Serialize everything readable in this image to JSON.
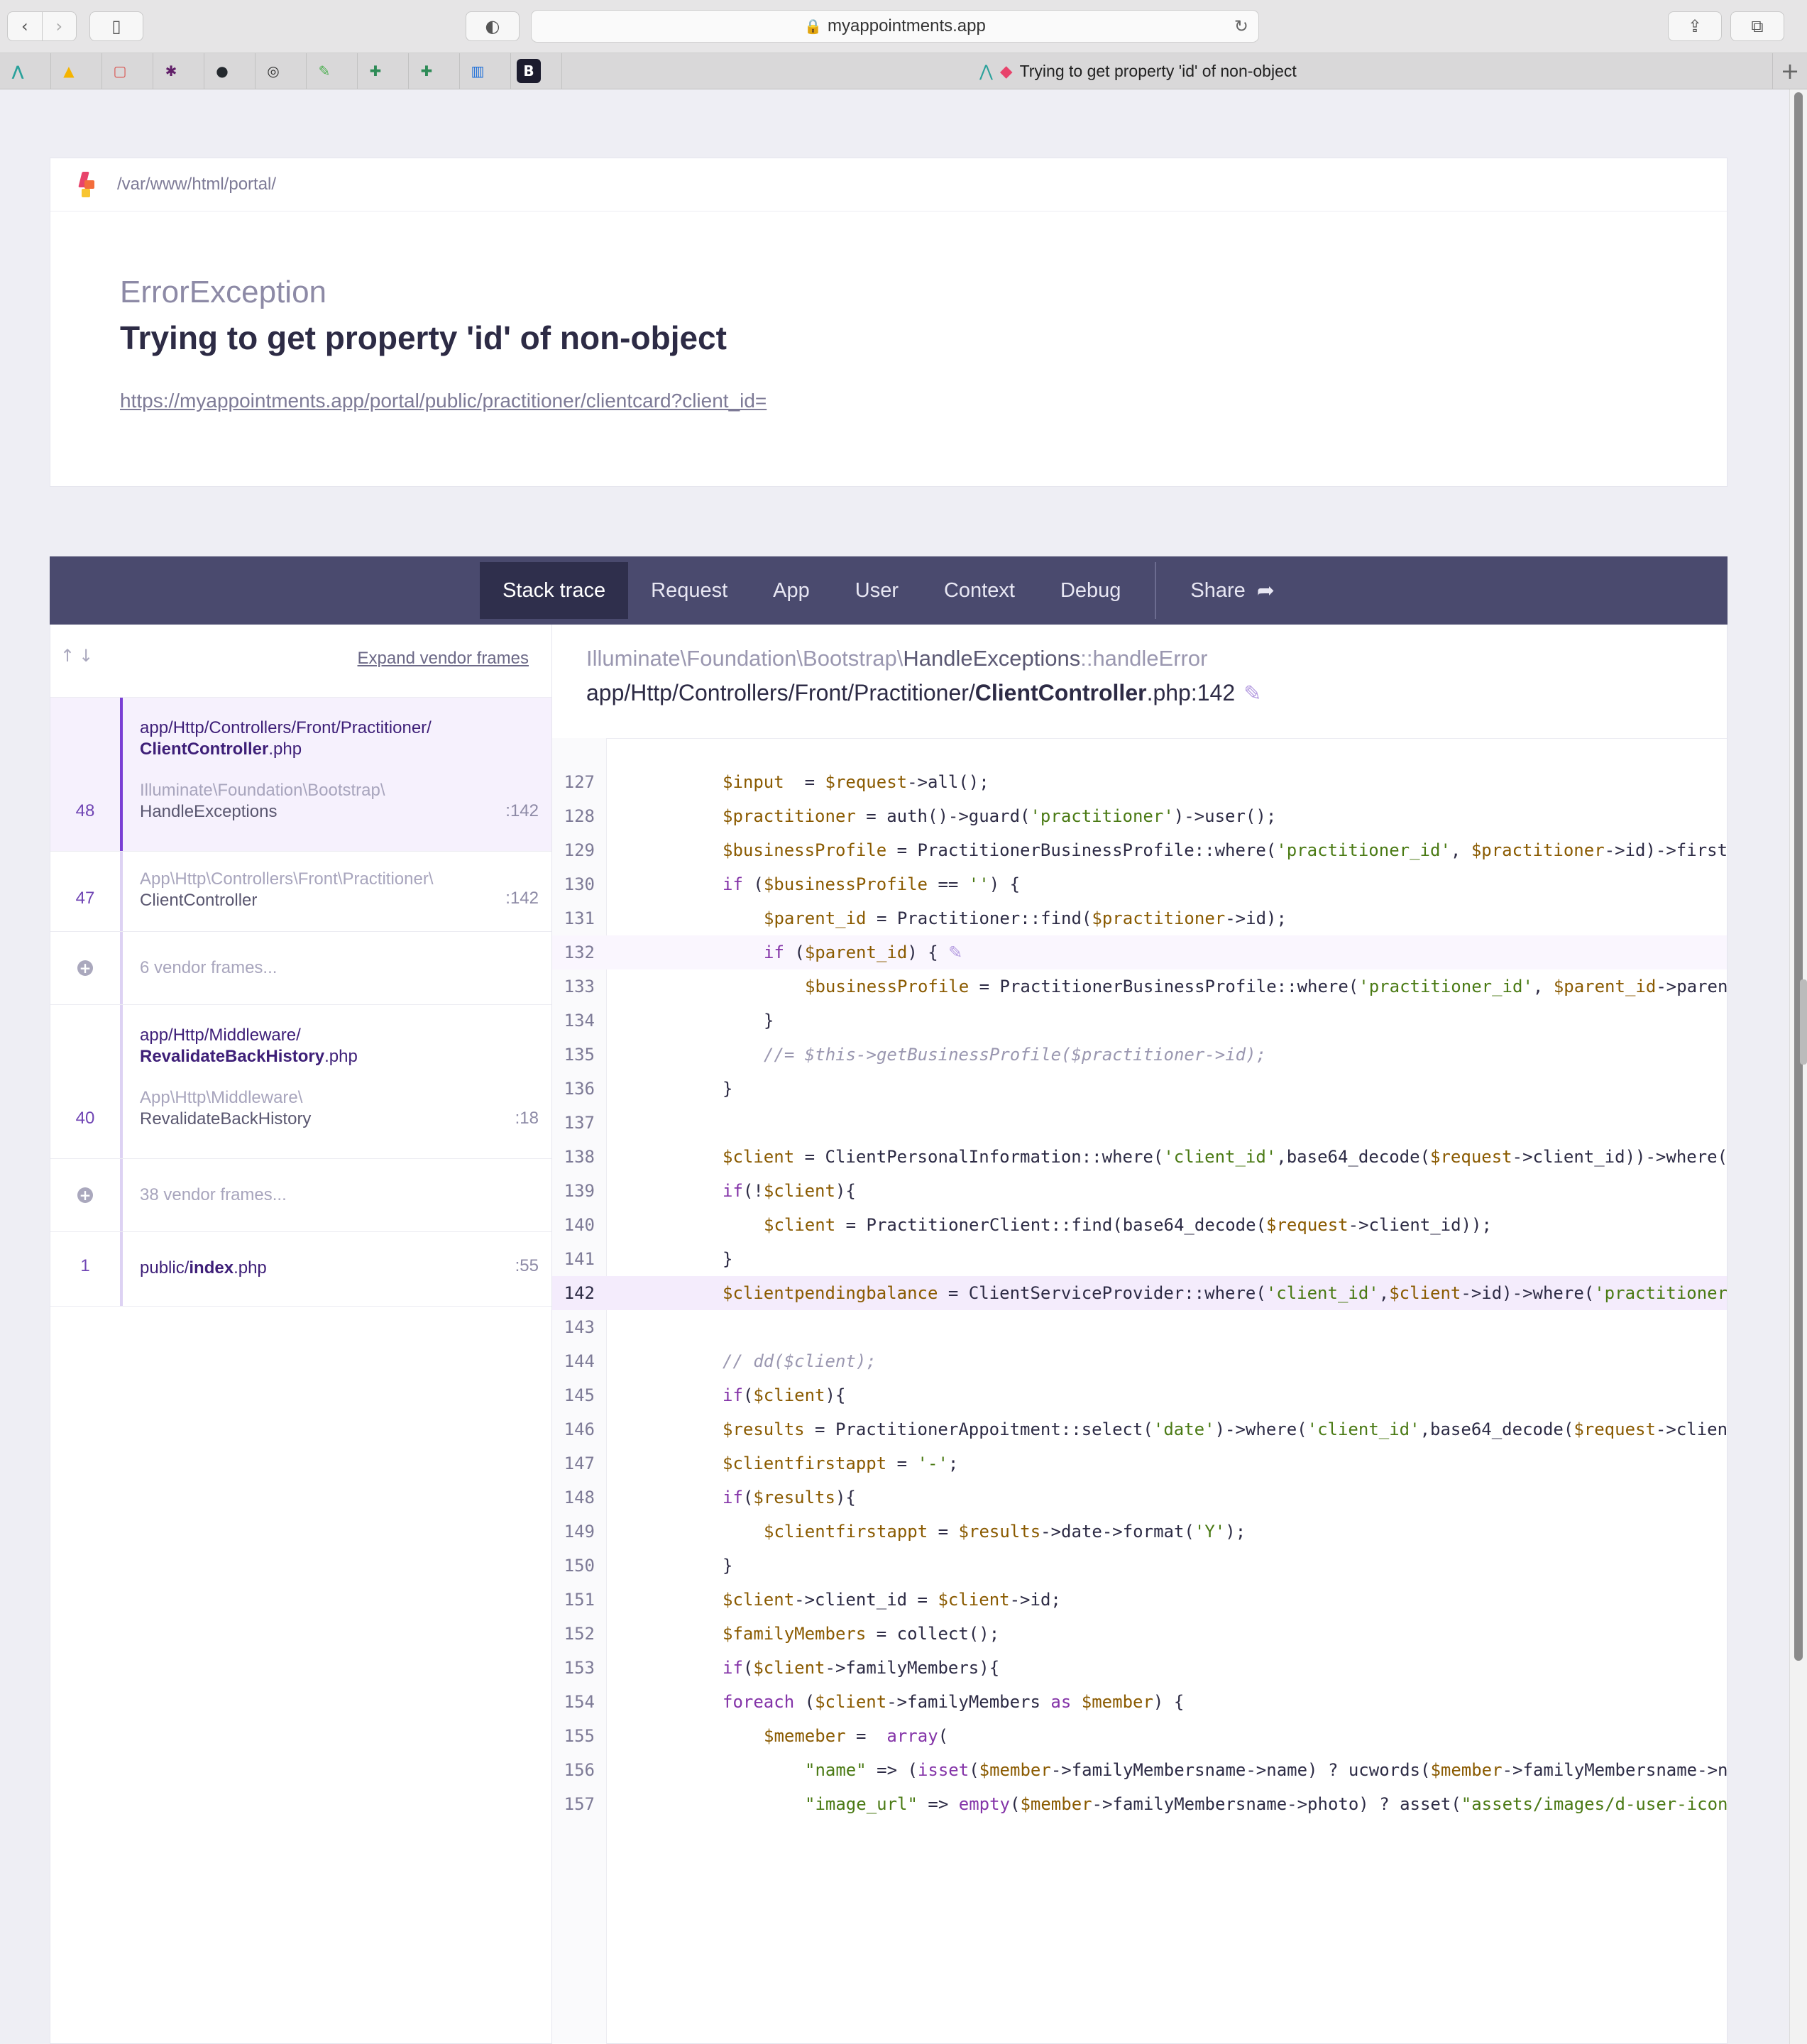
{
  "browser": {
    "url": "myappointments.app",
    "tab_title": "Trying to get property 'id' of non-object",
    "bookmarks": [
      {
        "icon": "ms-planner-icon",
        "color": "#2aa19b",
        "glyph": "⋀"
      },
      {
        "icon": "google-drive-icon",
        "color": "#f5b400",
        "glyph": "▲"
      },
      {
        "icon": "chat-bubble-icon",
        "color": "#d9534f",
        "glyph": "▢"
      },
      {
        "icon": "slack-icon",
        "color": "#611f69",
        "glyph": "✱"
      },
      {
        "icon": "github-icon",
        "color": "#24292e",
        "glyph": "●"
      },
      {
        "icon": "lifebuoy-icon",
        "color": "#333333",
        "glyph": "◎"
      },
      {
        "icon": "leaf-icon",
        "color": "#4caf50",
        "glyph": "✎"
      },
      {
        "icon": "sheets-plus-icon",
        "color": "#2e8b57",
        "glyph": "✚"
      },
      {
        "icon": "sheets-plus-icon-2",
        "color": "#2e8b57",
        "glyph": "✚"
      },
      {
        "icon": "trello-icon",
        "color": "#1e6fd9",
        "glyph": "▥"
      },
      {
        "icon": "bold-b-icon",
        "color": "#1c1c2e",
        "glyph": "B"
      }
    ]
  },
  "header": {
    "app_path": "/var/www/html/portal/",
    "exception_class": "ErrorException",
    "message": "Trying to get property 'id' of non-object",
    "request_url": "https://myappointments.app/portal/public/practitioner/clientcard?client_id="
  },
  "nav": {
    "tabs": [
      "Stack trace",
      "Request",
      "App",
      "User",
      "Context",
      "Debug"
    ],
    "active": "Stack trace",
    "share": "Share"
  },
  "stack": {
    "expand_vendor": "Expand vendor frames",
    "frames": [
      {
        "number": "48",
        "path_dir": "app/Http/Controllers/Front/Practitioner/",
        "path_file": "ClientController",
        "path_ext": ".php",
        "class_ns": "Illuminate\\Foundation\\Bootstrap\\",
        "class_name": "HandleExceptions",
        "line": ":142"
      },
      {
        "number": "47",
        "class_ns": "App\\Http\\Controllers\\Front\\Practitioner\\",
        "class_name": "ClientController",
        "line": ":142"
      },
      {
        "vendor": "6 vendor frames..."
      },
      {
        "number": "40",
        "path_dir": "app/Http/Middleware/",
        "path_file": "RevalidateBackHistory",
        "path_ext": ".php",
        "class_ns": "App\\Http\\Middleware\\",
        "class_name": "RevalidateBackHistory",
        "line": ":18"
      },
      {
        "vendor": "38 vendor frames..."
      },
      {
        "number": "1",
        "path_dir": "public/",
        "path_file": "index",
        "path_ext": ".php",
        "line": ":55"
      }
    ]
  },
  "code": {
    "namespace": "Illuminate\\Foundation\\Bootstrap\\",
    "class": "HandleExceptions",
    "method": "::handleError",
    "file_dir": "app/Http/Controllers/Front/Practitioner/",
    "file_name": "ClientController",
    "file_ext": ".php:142",
    "highlight_line": 142,
    "lines": [
      {
        "n": "127",
        "indent": 0,
        "html": "<span class=\"v\">$input</span>  = <span class=\"v\">$request</span>-&gt;all();"
      },
      {
        "n": "128",
        "indent": 0,
        "html": "<span class=\"v\">$practitioner</span> = auth()-&gt;guard(<span class=\"s\">'practitioner'</span>)-&gt;user();"
      },
      {
        "n": "129",
        "indent": 0,
        "html": "<span class=\"v\">$businessProfile</span> = PractitionerBusinessProfile::where(<span class=\"s\">'practitioner_id'</span>, <span class=\"v\">$practitioner</span>-&gt;id)-&gt;first"
      },
      {
        "n": "130",
        "indent": 0,
        "html": "<span class=\"k\">if</span> (<span class=\"v\">$businessProfile</span> == <span class=\"s\">''</span>) {"
      },
      {
        "n": "131",
        "indent": 1,
        "html": "<span class=\"v\">$parent_id</span> = Practitioner::find(<span class=\"v\">$practitioner</span>-&gt;id);"
      },
      {
        "n": "132",
        "indent": 1,
        "html": "<span class=\"k\">if</span> (<span class=\"v\">$parent_id</span>) { <span class=\"pin\">✎</span>",
        "soft": true
      },
      {
        "n": "133",
        "indent": 2,
        "html": "<span class=\"v\">$businessProfile</span> = PractitionerBusinessProfile::where(<span class=\"s\">'practitioner_id'</span>, <span class=\"v\">$parent_id</span>-&gt;paren"
      },
      {
        "n": "134",
        "indent": 1,
        "html": "}"
      },
      {
        "n": "135",
        "indent": 1,
        "html": "<span class=\"c\">//= $this-&gt;getBusinessProfile($practitioner-&gt;id);</span>"
      },
      {
        "n": "136",
        "indent": 0,
        "html": "}"
      },
      {
        "n": "137",
        "indent": 0,
        "html": ""
      },
      {
        "n": "138",
        "indent": 0,
        "html": "<span class=\"v\">$client</span> = ClientPersonalInformation::where(<span class=\"s\">'client_id'</span>,base64_decode(<span class=\"v\">$request</span>-&gt;client_id))-&gt;where("
      },
      {
        "n": "139",
        "indent": 0,
        "html": "<span class=\"k\">if</span>(!<span class=\"v\">$client</span>){"
      },
      {
        "n": "140",
        "indent": 1,
        "html": "<span class=\"v\">$client</span> = PractitionerClient::find(base64_decode(<span class=\"v\">$request</span>-&gt;client_id));"
      },
      {
        "n": "141",
        "indent": 0,
        "html": "}"
      },
      {
        "n": "142",
        "indent": 0,
        "html": "<span class=\"v\">$clientpendingbalance</span> = ClientServiceProvider::where(<span class=\"s\">'client_id'</span>,<span class=\"v\">$client</span>-&gt;id)-&gt;where(<span class=\"s\">'practitioner</span>",
        "main": true
      },
      {
        "n": "143",
        "indent": 0,
        "html": ""
      },
      {
        "n": "144",
        "indent": 0,
        "html": "<span class=\"c\">// dd($client);</span>"
      },
      {
        "n": "145",
        "indent": 0,
        "html": "<span class=\"k\">if</span>(<span class=\"v\">$client</span>){"
      },
      {
        "n": "146",
        "indent": 0,
        "html": "<span class=\"v\">$results</span> = PractitionerAppoitment::select(<span class=\"s\">'date'</span>)-&gt;where(<span class=\"s\">'client_id'</span>,base64_decode(<span class=\"v\">$request</span>-&gt;clien"
      },
      {
        "n": "147",
        "indent": 0,
        "html": "<span class=\"v\">$clientfirstappt</span> = <span class=\"s\">'-'</span>;"
      },
      {
        "n": "148",
        "indent": 0,
        "html": "<span class=\"k\">if</span>(<span class=\"v\">$results</span>){"
      },
      {
        "n": "149",
        "indent": 1,
        "html": "<span class=\"v\">$clientfirstappt</span> = <span class=\"v\">$results</span>-&gt;date-&gt;format(<span class=\"s\">'Y'</span>);"
      },
      {
        "n": "150",
        "indent": 0,
        "html": "}"
      },
      {
        "n": "151",
        "indent": 0,
        "html": "<span class=\"v\">$client</span>-&gt;client_id = <span class=\"v\">$client</span>-&gt;id;"
      },
      {
        "n": "152",
        "indent": 0,
        "html": "<span class=\"v\">$familyMembers</span> = collect();"
      },
      {
        "n": "153",
        "indent": 0,
        "html": "<span class=\"k\">if</span>(<span class=\"v\">$client</span>-&gt;familyMembers){"
      },
      {
        "n": "154",
        "indent": 0,
        "html": "<span class=\"k\">foreach</span> (<span class=\"v\">$client</span>-&gt;familyMembers <span class=\"k\">as</span> <span class=\"v\">$member</span>) {"
      },
      {
        "n": "155",
        "indent": 1,
        "html": "<span class=\"v\">$memeber</span> =  <span class=\"k\">array</span>("
      },
      {
        "n": "156",
        "indent": 2,
        "html": "<span class=\"s\">\"name\"</span> =&gt; (<span class=\"k\">isset</span>(<span class=\"v\">$member</span>-&gt;familyMembersname-&gt;name) ? ucwords(<span class=\"v\">$member</span>-&gt;familyMembersname-&gt;n"
      },
      {
        "n": "157",
        "indent": 2,
        "html": "<span class=\"s\">\"image_url\"</span> =&gt; <span class=\"k\">empty</span>(<span class=\"v\">$member</span>-&gt;familyMembersname-&gt;photo) ? asset(<span class=\"s\">\"assets/images/d-user-icon</span>"
      }
    ]
  }
}
